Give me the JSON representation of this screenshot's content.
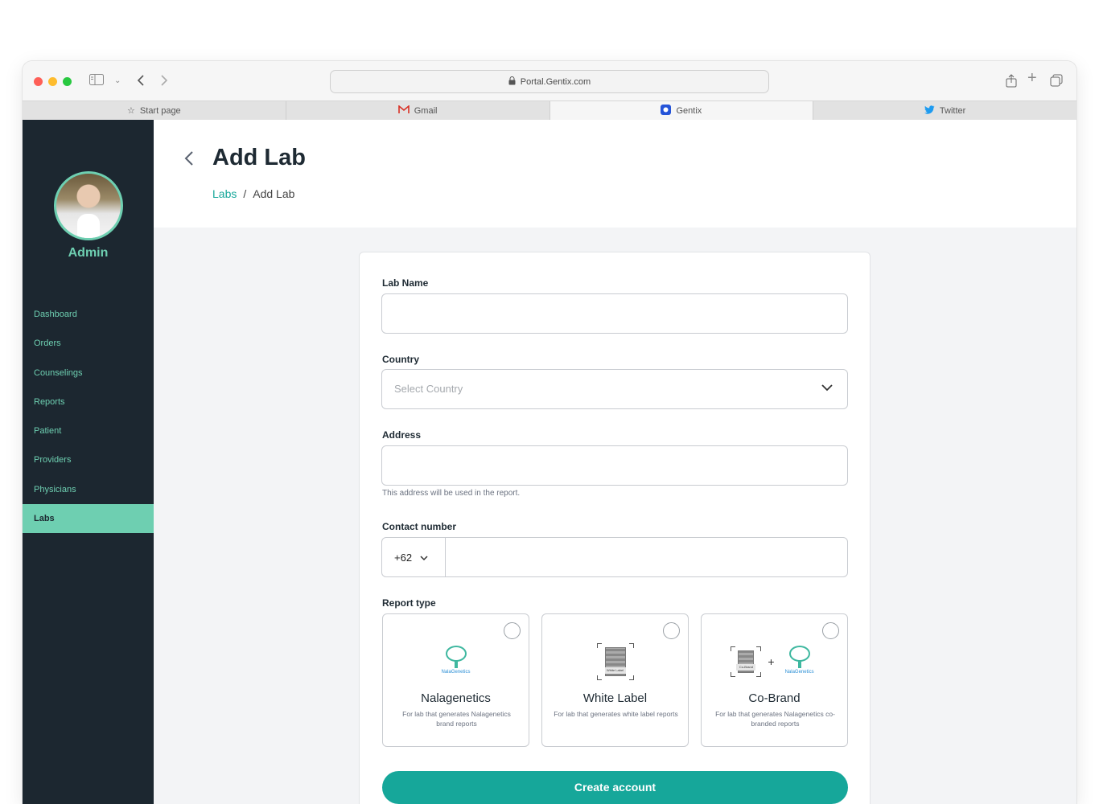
{
  "browser": {
    "url": "Portal.Gentix.com",
    "tabs": [
      {
        "label": "Start page"
      },
      {
        "label": "Gmail"
      },
      {
        "label": "Gentix"
      },
      {
        "label": "Twitter"
      }
    ]
  },
  "sidebar": {
    "user_name": "Admin",
    "items": [
      {
        "label": "Dashboard"
      },
      {
        "label": "Orders"
      },
      {
        "label": "Counselings"
      },
      {
        "label": "Reports"
      },
      {
        "label": "Patient"
      },
      {
        "label": "Providers"
      },
      {
        "label": "Physicians"
      },
      {
        "label": "Labs",
        "active": true
      }
    ]
  },
  "header": {
    "title": "Add Lab",
    "breadcrumb": {
      "parent": "Labs",
      "separator": "/",
      "current": "Add Lab"
    }
  },
  "form": {
    "lab_name": {
      "label": "Lab Name",
      "value": ""
    },
    "country": {
      "label": "Country",
      "placeholder": "Select Country"
    },
    "address": {
      "label": "Address",
      "value": "",
      "hint": "This address will be used in the report."
    },
    "contact": {
      "label": "Contact number",
      "country_code": "+62",
      "value": ""
    },
    "report_type": {
      "label": "Report type",
      "options": [
        {
          "title": "Nalagenetics",
          "description": "For lab that generates Nalagenetics brand reports",
          "logo_text": "NalaGenetics"
        },
        {
          "title": "White Label",
          "description": "For lab that generates white label reports",
          "logo_text": "White Label"
        },
        {
          "title": "Co-Brand",
          "description": "For lab that generates Nalagenetics co-branded reports",
          "logo_text": "NalaGenetics",
          "tag_text": "Co-Brand"
        }
      ]
    },
    "submit_label": "Create account"
  },
  "colors": {
    "accent": "#16a79a",
    "sidebar_bg": "#1c2730",
    "sidebar_text": "#6ecfb1"
  }
}
